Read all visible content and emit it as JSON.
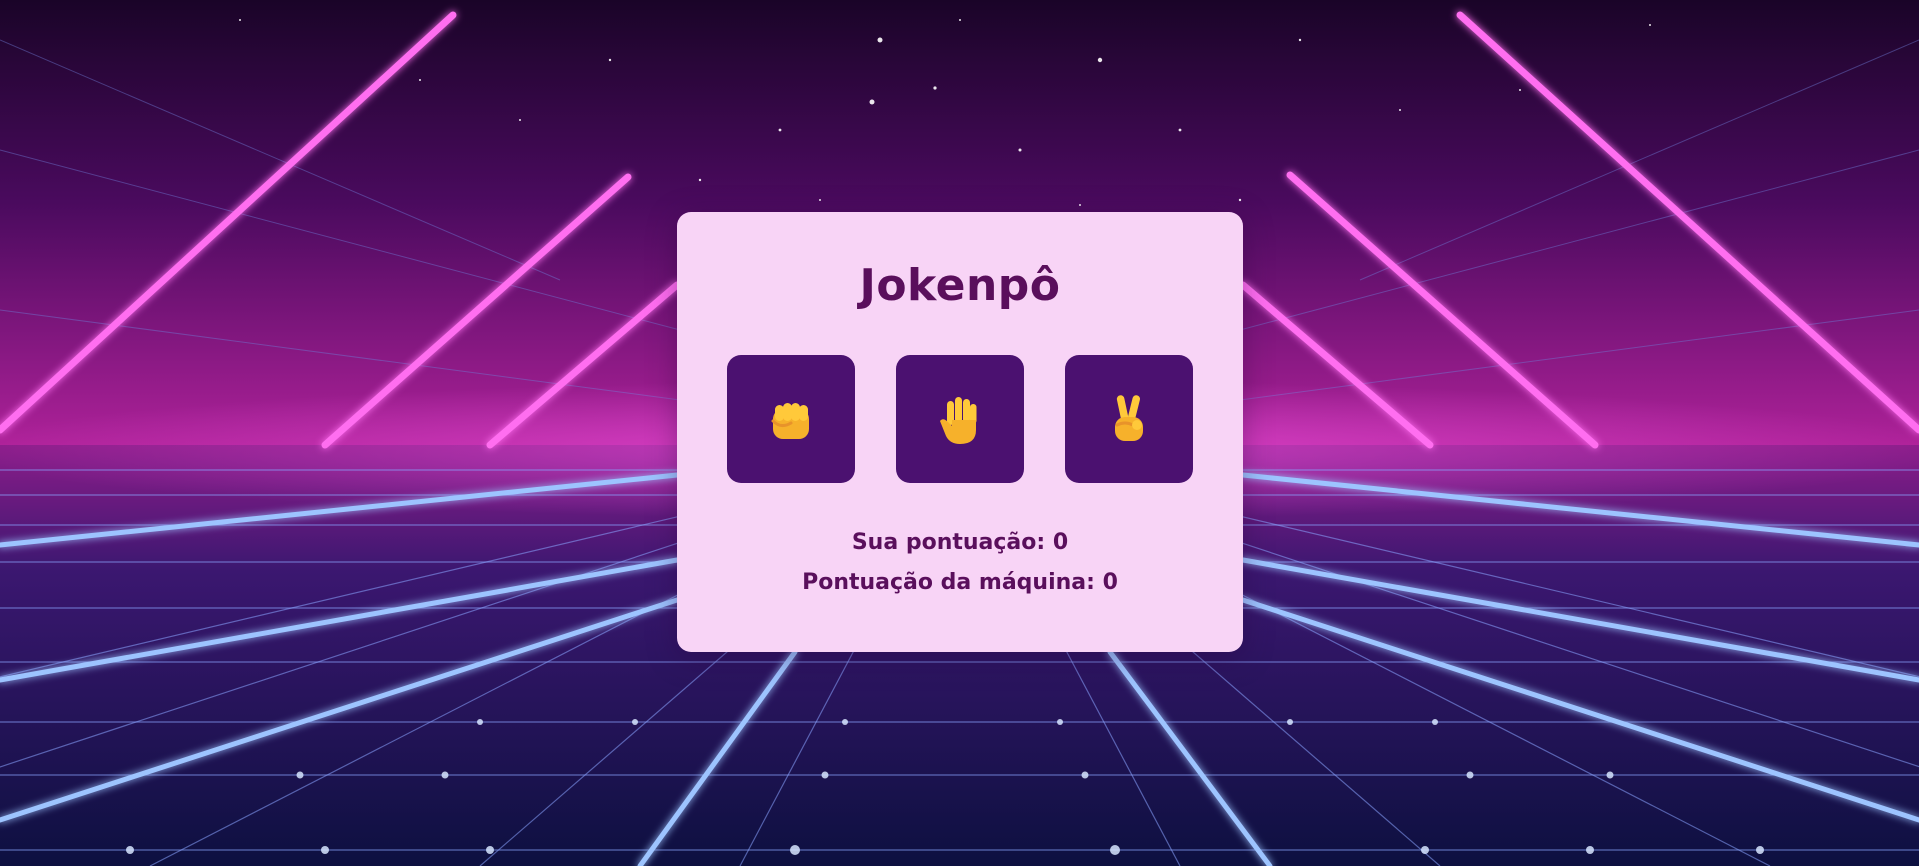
{
  "game": {
    "title": "Jokenpô",
    "choices": [
      {
        "id": "rock",
        "icon": "fist-icon"
      },
      {
        "id": "paper",
        "icon": "open-hand-icon"
      },
      {
        "id": "scissors",
        "icon": "victory-hand-icon"
      }
    ],
    "player_score_label": "Sua pontuação: ",
    "player_score": "0",
    "machine_score_label": "Pontuação da máquina: ",
    "machine_score": "0"
  },
  "colors": {
    "card_background": "#f8d4f6",
    "text": "#5a0f5c",
    "button_background": "#4b1170",
    "neon_pink": "#ff4fe0",
    "neon_blue": "#6fa8ff"
  }
}
